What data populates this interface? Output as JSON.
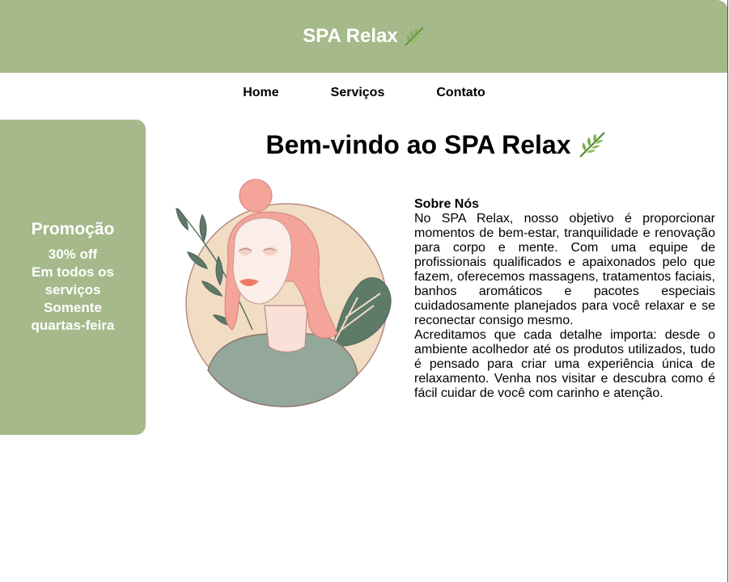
{
  "header": {
    "title": "SPA Relax",
    "leaf_icon": "herb-leaf-icon"
  },
  "nav": {
    "items": [
      {
        "label": "Home"
      },
      {
        "label": "Serviços"
      },
      {
        "label": "Contato"
      }
    ]
  },
  "promo": {
    "title": "Promoção",
    "lines": [
      "30% off",
      "Em todos os",
      "serviços",
      "Somente",
      "quartas-feira"
    ]
  },
  "main": {
    "title": "Bem-vindo ao SPA Relax"
  },
  "about": {
    "title": "Sobre Nós",
    "paragraph1": "No SPA Relax, nosso objetivo é proporcionar momentos de bem-estar, tranquilidade e renovação para corpo e mente. Com uma equipe de profissionais qualificados e apaixonados pelo que fazem, oferecemos massagens, tratamentos faciais, banhos aromáticos e pacotes especiais cuidadosamente planejados para você relaxar e se reconectar consigo mesmo.",
    "paragraph2": "Acreditamos que cada detalhe importa: desde o ambiente acolhedor até os produtos utilizados, tudo é pensado para criar uma experiência única de relaxamento. Venha nos visitar e descubra como é fácil cuidar de você com carinho e atenção."
  },
  "colors": {
    "accent": "#a5b98a",
    "text": "#000000",
    "on_accent": "#ffffff"
  }
}
